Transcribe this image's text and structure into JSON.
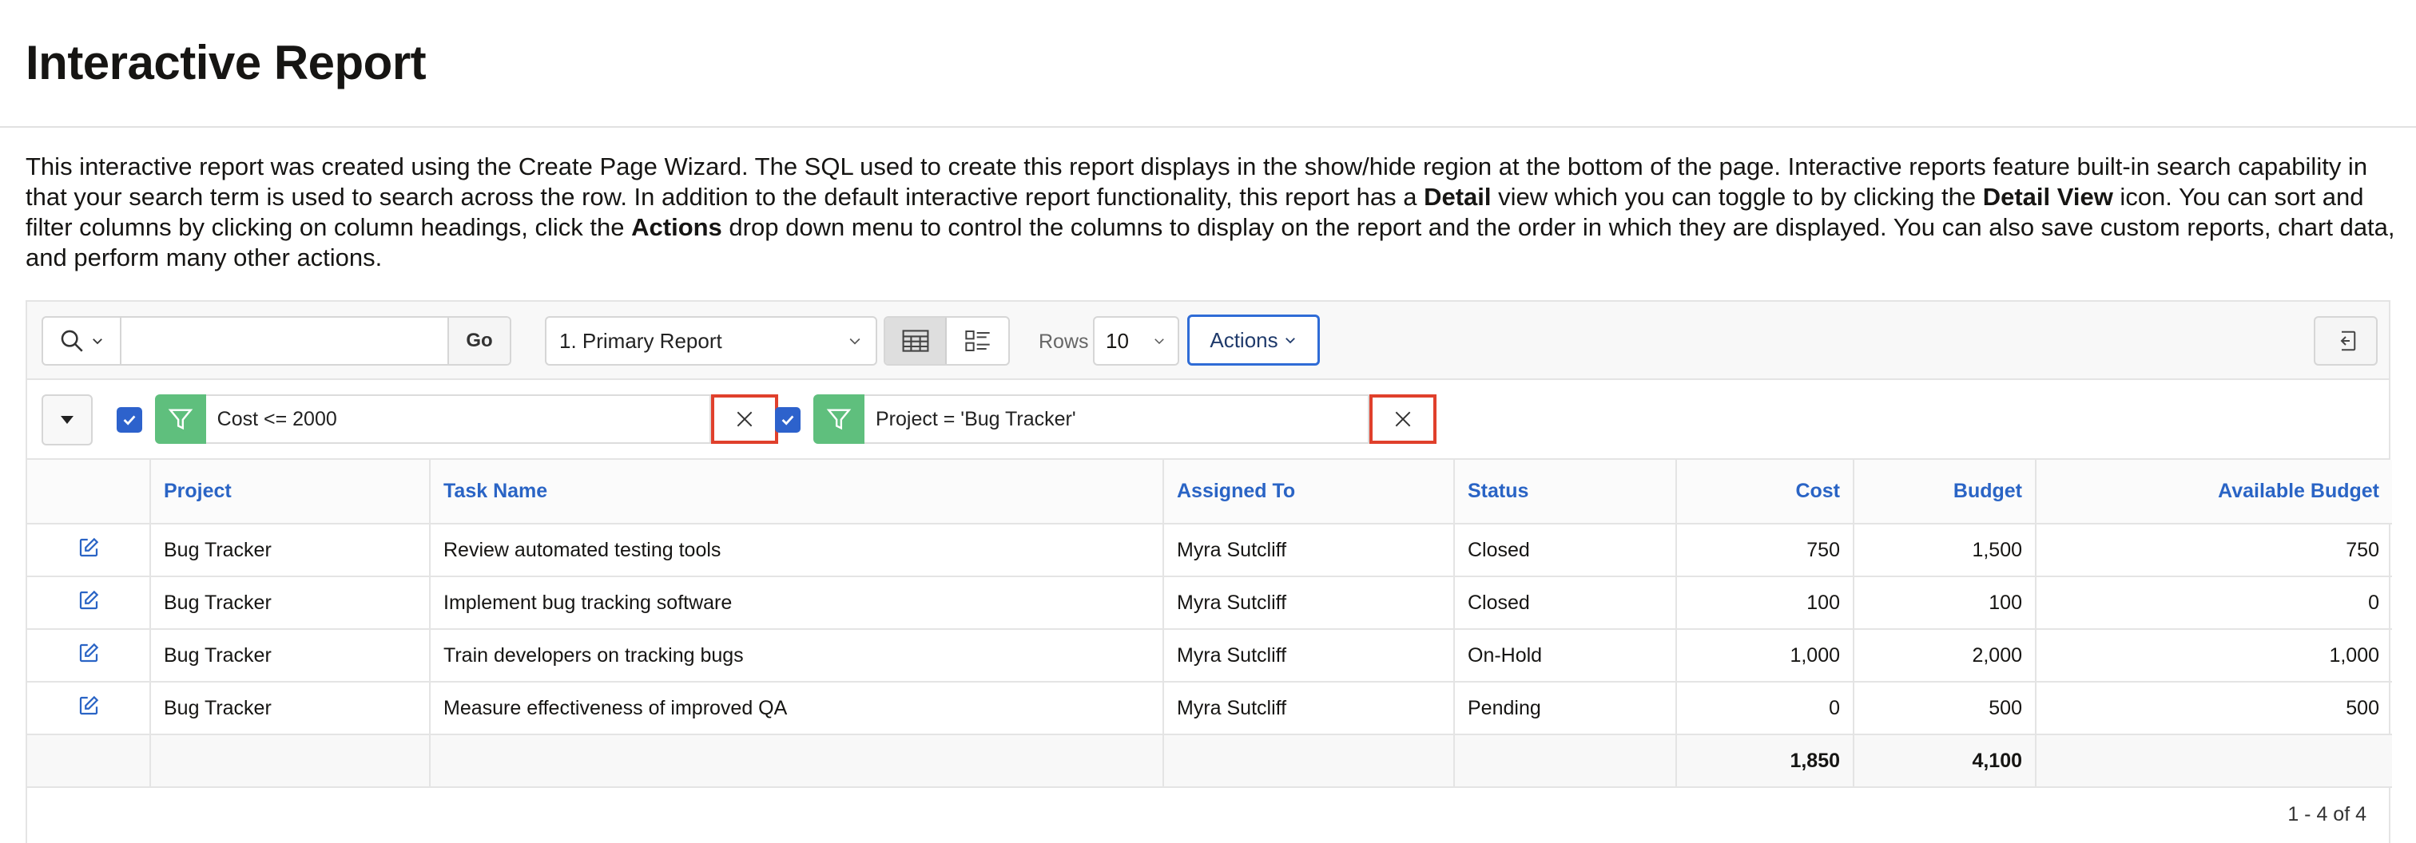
{
  "page": {
    "title": "Interactive Report"
  },
  "intro": {
    "part1": "This interactive report was created using the Create Page Wizard. The SQL used to create this report displays in the show/hide region at the bottom of the page. Interactive reports feature built-in search capability in that your search term is used to search across the row. In addition to the default interactive report functionality, this report has a ",
    "bold1": "Detail",
    "part2": " view which you can toggle to by clicking the ",
    "bold2": "Detail View",
    "part3": " icon. You can sort and filter columns by clicking on column headings, click the ",
    "bold3": "Actions",
    "part4": " drop down menu to control the columns to display on the report and the order in which they are displayed. You can also save custom reports, chart data, and perform many other actions."
  },
  "toolbar": {
    "search_value": "",
    "go_label": "Go",
    "report_select": "1. Primary Report",
    "rows_label": "Rows",
    "rows_value": "10",
    "actions_label": "Actions"
  },
  "filters": [
    {
      "text": "Cost <= 2000",
      "enabled": true
    },
    {
      "text": "Project = 'Bug Tracker'",
      "enabled": true
    }
  ],
  "table": {
    "headers": [
      "Project",
      "Task Name",
      "Assigned To",
      "Status",
      "Cost",
      "Budget",
      "Available Budget"
    ],
    "rows": [
      [
        "Bug Tracker",
        "Review automated testing tools",
        "Myra Sutcliff",
        "Closed",
        "750",
        "1,500",
        "750"
      ],
      [
        "Bug Tracker",
        "Implement bug tracking software",
        "Myra Sutcliff",
        "Closed",
        "100",
        "100",
        "0"
      ],
      [
        "Bug Tracker",
        "Train developers on tracking bugs",
        "Myra Sutcliff",
        "On-Hold",
        "1,000",
        "2,000",
        "1,000"
      ],
      [
        "Bug Tracker",
        "Measure effectiveness of improved QA",
        "Myra Sutcliff",
        "Pending",
        "0",
        "500",
        "500"
      ]
    ],
    "totals": {
      "cost": "1,850",
      "budget": "4,100"
    }
  },
  "pagination": "1 - 4 of 4",
  "colors": {
    "accent_blue": "#2a64c5",
    "filter_green": "#5fbf7d",
    "highlight_red": "#e0402c",
    "checkbox_blue": "#2d62cc"
  },
  "icons": {
    "search": "search-icon",
    "filter": "filter-icon",
    "remove": "close-icon",
    "edit": "edit-icon",
    "reset": "reset-icon",
    "grid_view": "grid-view-icon",
    "detail_view": "detail-view-icon"
  }
}
